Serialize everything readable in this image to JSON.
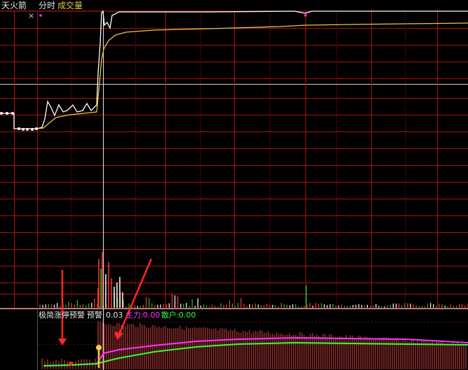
{
  "header": {
    "indicator_name": "天火箭",
    "chart_period": "分时",
    "volume_label": "成交量"
  },
  "close_button": "×",
  "indicator_line": {
    "name": "极简涨停预警",
    "warn_label": "预警:",
    "warn_value": "0.03",
    "main_label": "主力:",
    "main_value": "0.00",
    "retail_label": "散户:",
    "retail_value": "0.00"
  },
  "colors": {
    "background": "#000000",
    "grid": "#b01010",
    "price_line": "#ffffff",
    "avg_price_line": "#e6c84a",
    "volume_up": "#ff3b3b",
    "volume_neutral": "#ffffff",
    "volume_down": "#22c322",
    "main_force": "#ff33ff",
    "retail": "#33ff33",
    "annotation_arrow": "#ff2a2a",
    "warn_text": "#ffffff"
  },
  "icons": {
    "close": "close-icon",
    "annotation": "red-arrow-icon",
    "signal": "coin-signal-icon"
  }
}
